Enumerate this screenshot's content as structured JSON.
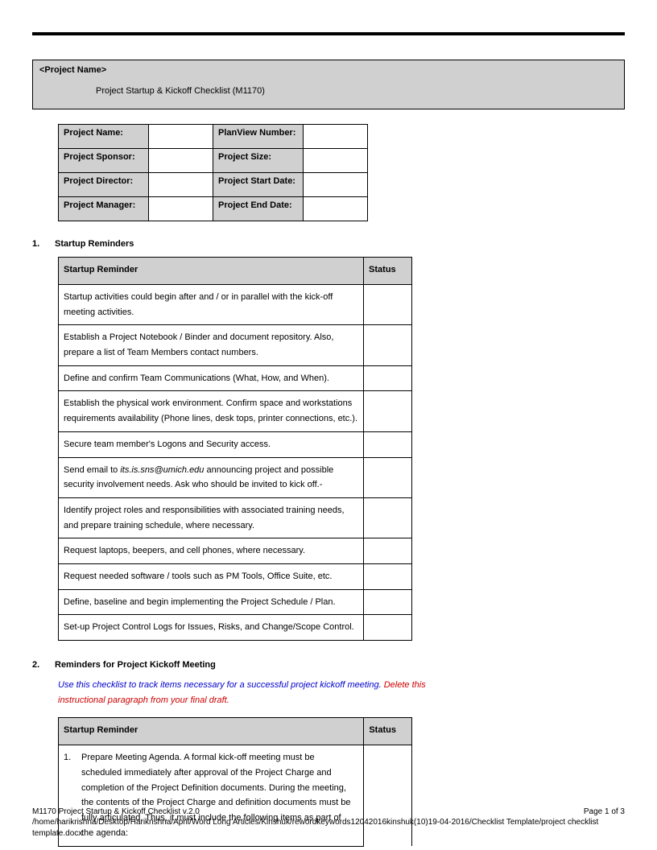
{
  "header": {
    "project_placeholder": "<Project Name>",
    "subtitle": "Project Startup & Kickoff Checklist (M1170)"
  },
  "info_labels": {
    "r1c1": "Project Name:",
    "r1c3": "PlanView Number:",
    "r2c1": "Project Sponsor:",
    "r2c3": "Project Size:",
    "r3c1": "Project Director:",
    "r3c3": "Project Start Date:",
    "r4c1": "Project Manager:",
    "r4c3": "Project End Date:"
  },
  "section1": {
    "num": "1.",
    "title": "Startup Reminders",
    "col1": "Startup Reminder",
    "col2": "Status",
    "rows": [
      "Startup activities could begin after and / or in parallel with the kick-off meeting activities.",
      "Establish a Project Notebook / Binder and document repository. Also, prepare a list of Team Members contact numbers.",
      "Define and confirm Team Communications (What, How, and When).",
      "Establish the physical work environment. Confirm space and workstations requirements availability (Phone lines, desk tops, printer connections, etc.).",
      "Secure team member's Logons and Security access.",
      "Send email to <span class=\"email-italic\">its.is.sns@umich.edu</span> announcing project and possible security involvement needs.  Ask who should be invited to kick off.-",
      "Identify project roles and responsibilities with associated training needs, and prepare training schedule, where necessary.",
      "Request laptops, beepers, and cell phones, where necessary.",
      "Request needed software / tools such as PM Tools, Office Suite, etc.",
      "Define, baseline and begin implementing the Project Schedule / Plan.",
      "Set-up Project Control Logs for Issues, Risks, and Change/Scope Control."
    ]
  },
  "section2": {
    "num": "2.",
    "title": "Reminders for Project Kickoff Meeting",
    "instr_blue": "Use this checklist to track items necessary for a successful project kickoff meeting.",
    "instr_red": "Delete this instructional paragraph from your final draft.",
    "col1": "Startup Reminder",
    "col2": "Status",
    "row1_num": "1.",
    "row1_text": "Prepare Meeting Agenda. A formal kick-off meeting must be scheduled immediately after approval of the Project Charge and completion of the Project Definition documents. During the meeting, the contents of the Project Charge and definition documents must be fully articulated. Thus, it must include the following items as part of the agenda:"
  },
  "footer": {
    "line1": "M1170 Project Startup & Kickoff Checklist v.2.0",
    "line2": "/home/harikrishna/Desktop/Harikrishna/April/Word Long Articles/Kinshuk/rewordkeywords12042016kinshuk(10)19-04-2016/Checklist Template/project checklist template.docx",
    "page": "Page 1 of 3"
  }
}
